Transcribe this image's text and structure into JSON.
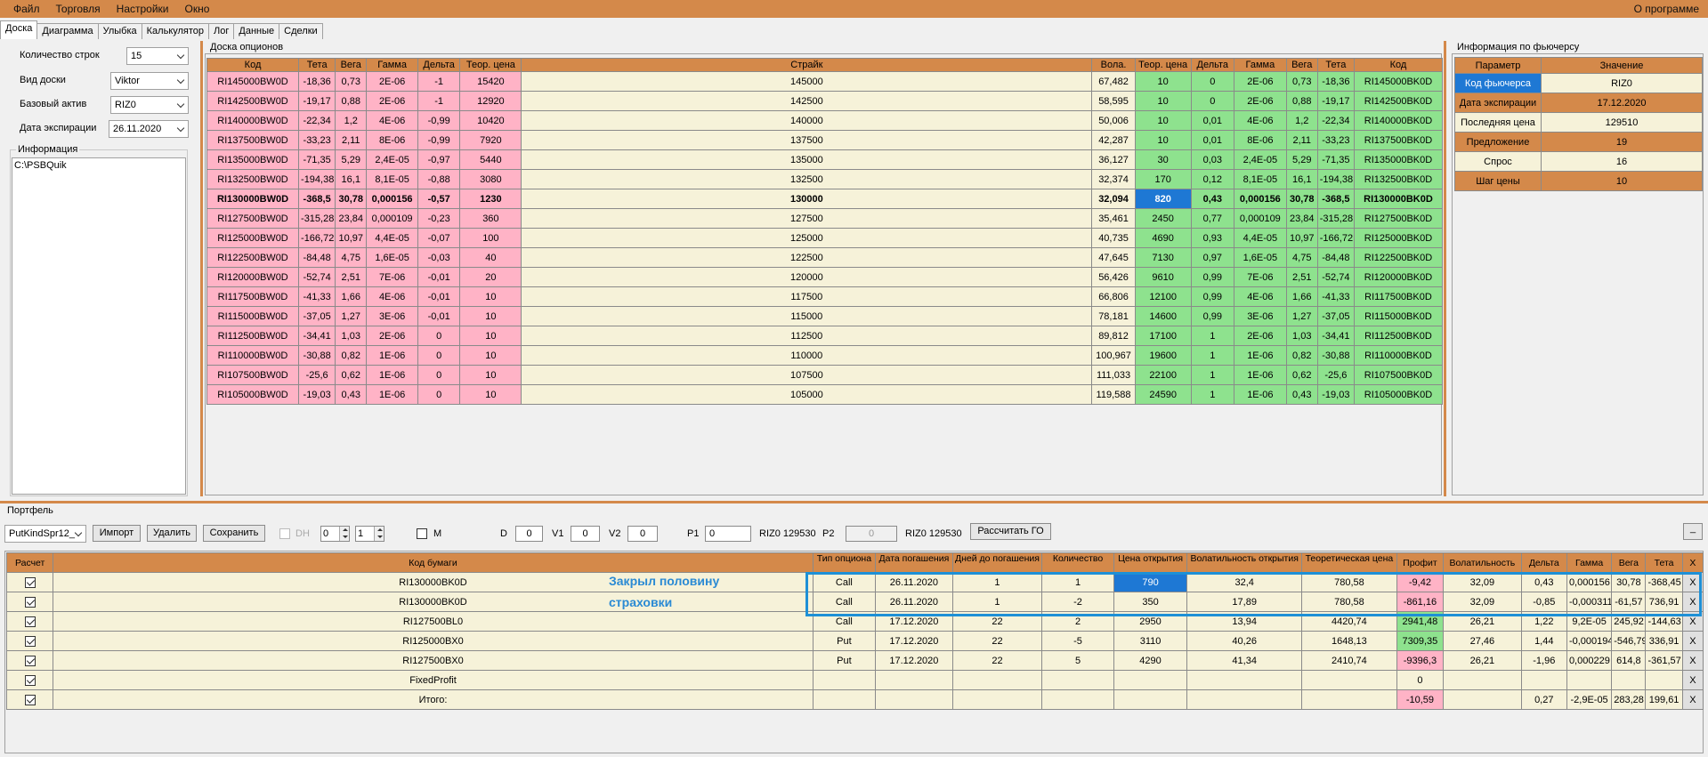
{
  "menu": [
    "Файл",
    "Торговля",
    "Настройки",
    "Окно"
  ],
  "menu_right": "О программе",
  "tabs": [
    "Доска",
    "Диаграмма",
    "Улыбка",
    "Калькулятор",
    "Лог",
    "Данные",
    "Сделки"
  ],
  "left": {
    "rows_label": "Количество строк",
    "rows_value": "15",
    "view_label": "Вид доски",
    "view_value": "Viktor",
    "asset_label": "Базовый актив",
    "asset_value": "RIZ0",
    "exp_label": "Дата экспирации",
    "exp_value": "26.11.2020",
    "info_caption": "Информация",
    "info_text": "C:\\PSBQuik"
  },
  "board": {
    "caption": "Доска опционов",
    "headers": [
      "Код",
      "Тета",
      "Вега",
      "Гамма",
      "Дельта",
      "Теор. цена",
      "Страйк",
      "Вола.",
      "Теор. цена",
      "Дельта",
      "Гамма",
      "Вега",
      "Тета",
      "Код"
    ],
    "rows": [
      [
        "RI145000BW0D",
        "-18,36",
        "0,73",
        "2E-06",
        "-1",
        "15420",
        "145000",
        "67,482",
        "10",
        "0",
        "2E-06",
        "0,73",
        "-18,36",
        "RI145000BK0D"
      ],
      [
        "RI142500BW0D",
        "-19,17",
        "0,88",
        "2E-06",
        "-1",
        "12920",
        "142500",
        "58,595",
        "10",
        "0",
        "2E-06",
        "0,88",
        "-19,17",
        "RI142500BK0D"
      ],
      [
        "RI140000BW0D",
        "-22,34",
        "1,2",
        "4E-06",
        "-0,99",
        "10420",
        "140000",
        "50,006",
        "10",
        "0,01",
        "4E-06",
        "1,2",
        "-22,34",
        "RI140000BK0D"
      ],
      [
        "RI137500BW0D",
        "-33,23",
        "2,11",
        "8E-06",
        "-0,99",
        "7920",
        "137500",
        "42,287",
        "10",
        "0,01",
        "8E-06",
        "2,11",
        "-33,23",
        "RI137500BK0D"
      ],
      [
        "RI135000BW0D",
        "-71,35",
        "5,29",
        "2,4E-05",
        "-0,97",
        "5440",
        "135000",
        "36,127",
        "30",
        "0,03",
        "2,4E-05",
        "5,29",
        "-71,35",
        "RI135000BK0D"
      ],
      [
        "RI132500BW0D",
        "-194,38",
        "16,1",
        "8,1E-05",
        "-0,88",
        "3080",
        "132500",
        "32,374",
        "170",
        "0,12",
        "8,1E-05",
        "16,1",
        "-194,38",
        "RI132500BK0D"
      ],
      [
        "RI130000BW0D",
        "-368,5",
        "30,78",
        "0,000156",
        "-0,57",
        "1230",
        "130000",
        "32,094",
        "820",
        "0,43",
        "0,000156",
        "30,78",
        "-368,5",
        "RI130000BK0D"
      ],
      [
        "RI127500BW0D",
        "-315,28",
        "23,84",
        "0,000109",
        "-0,23",
        "360",
        "127500",
        "35,461",
        "2450",
        "0,77",
        "0,000109",
        "23,84",
        "-315,28",
        "RI127500BK0D"
      ],
      [
        "RI125000BW0D",
        "-166,72",
        "10,97",
        "4,4E-05",
        "-0,07",
        "100",
        "125000",
        "40,735",
        "4690",
        "0,93",
        "4,4E-05",
        "10,97",
        "-166,72",
        "RI125000BK0D"
      ],
      [
        "RI122500BW0D",
        "-84,48",
        "4,75",
        "1,6E-05",
        "-0,03",
        "40",
        "122500",
        "47,645",
        "7130",
        "0,97",
        "1,6E-05",
        "4,75",
        "-84,48",
        "RI122500BK0D"
      ],
      [
        "RI120000BW0D",
        "-52,74",
        "2,51",
        "7E-06",
        "-0,01",
        "20",
        "120000",
        "56,426",
        "9610",
        "0,99",
        "7E-06",
        "2,51",
        "-52,74",
        "RI120000BK0D"
      ],
      [
        "RI117500BW0D",
        "-41,33",
        "1,66",
        "4E-06",
        "-0,01",
        "10",
        "117500",
        "66,806",
        "12100",
        "0,99",
        "4E-06",
        "1,66",
        "-41,33",
        "RI117500BK0D"
      ],
      [
        "RI115000BW0D",
        "-37,05",
        "1,27",
        "3E-06",
        "-0,01",
        "10",
        "115000",
        "78,181",
        "14600",
        "0,99",
        "3E-06",
        "1,27",
        "-37,05",
        "RI115000BK0D"
      ],
      [
        "RI112500BW0D",
        "-34,41",
        "1,03",
        "2E-06",
        "0",
        "10",
        "112500",
        "89,812",
        "17100",
        "1",
        "2E-06",
        "1,03",
        "-34,41",
        "RI112500BK0D"
      ],
      [
        "RI110000BW0D",
        "-30,88",
        "0,82",
        "1E-06",
        "0",
        "10",
        "110000",
        "100,967",
        "19600",
        "1",
        "1E-06",
        "0,82",
        "-30,88",
        "RI110000BK0D"
      ],
      [
        "RI107500BW0D",
        "-25,6",
        "0,62",
        "1E-06",
        "0",
        "10",
        "107500",
        "111,033",
        "22100",
        "1",
        "1E-06",
        "0,62",
        "-25,6",
        "RI107500BK0D"
      ],
      [
        "RI105000BW0D",
        "-19,03",
        "0,43",
        "1E-06",
        "0",
        "10",
        "105000",
        "119,588",
        "24590",
        "1",
        "1E-06",
        "0,43",
        "-19,03",
        "RI105000BK0D"
      ]
    ]
  },
  "futures": {
    "caption": "Информация по фьючерсу",
    "headers": [
      "Параметр",
      "Значение"
    ],
    "rows": [
      [
        "Код фьючерса",
        "RIZ0"
      ],
      [
        "Дата экспирации",
        "17.12.2020"
      ],
      [
        "Последняя цена",
        "129510"
      ],
      [
        "Предложение",
        "19"
      ],
      [
        "Спрос",
        "16"
      ],
      [
        "Шаг цены",
        "10"
      ]
    ]
  },
  "portfolio": {
    "caption": "Портфель",
    "select_value": "PutKindSpr12_",
    "import_label": "Импорт",
    "delete_label": "Удалить",
    "save_label": "Сохранить",
    "dh_label": "DH",
    "spin1": "0",
    "spin2": "1",
    "m_label": "M",
    "d_label": "D",
    "d_value": "0",
    "v1_label": "V1",
    "v1_value": "0",
    "v2_label": "V2",
    "v2_value": "0",
    "p1_label": "P1",
    "p1_value": "0",
    "riz_1": "RIZ0 129530",
    "p2_label": "P2",
    "p2_value": "0",
    "riz_2": "RIZ0 129530",
    "calc_label": "Рассчитать ГО",
    "min_label": "_",
    "headers": [
      "Расчет",
      "Код бумаги",
      "Тип опциона",
      "Дата погашения",
      "Дней до погашения",
      "Количество",
      "Цена открытия",
      "Волатильность открытия",
      "Теоретическая цена",
      "Профит",
      "Волатильность",
      "Дельта",
      "Гамма",
      "Вега",
      "Тета",
      "X"
    ],
    "rows": [
      [
        "RI130000BK0D",
        "Call",
        "26.11.2020",
        "1",
        "1",
        "790",
        "32,4",
        "780,58",
        "-9,42",
        "32,09",
        "0,43",
        "0,000156",
        "30,78",
        "-368,45",
        "X"
      ],
      [
        "RI130000BK0D",
        "Call",
        "26.11.2020",
        "1",
        "-2",
        "350",
        "17,89",
        "780,58",
        "-861,16",
        "32,09",
        "-0,85",
        "-0,000311",
        "-61,57",
        "736,91",
        "X"
      ],
      [
        "RI127500BL0",
        "Call",
        "17.12.2020",
        "22",
        "2",
        "2950",
        "13,94",
        "4420,74",
        "2941,48",
        "26,21",
        "1,22",
        "9,2E-05",
        "245,92",
        "-144,63",
        "X"
      ],
      [
        "RI125000BX0",
        "Put",
        "17.12.2020",
        "22",
        "-5",
        "3110",
        "40,26",
        "1648,13",
        "7309,35",
        "27,46",
        "1,44",
        "-0,000194",
        "-546,79",
        "336,91",
        "X"
      ],
      [
        "RI127500BX0",
        "Put",
        "17.12.2020",
        "22",
        "5",
        "4290",
        "41,34",
        "2410,74",
        "-9396,3",
        "26,21",
        "-1,96",
        "0,000229",
        "614,8",
        "-361,57",
        "X"
      ],
      [
        "FixedProfit",
        "",
        "",
        "",
        "",
        "",
        "",
        "",
        "0",
        "",
        "",
        "",
        "",
        "",
        "X"
      ],
      [
        "Итого:",
        "",
        "",
        "",
        "",
        "",
        "",
        "",
        "-10,59",
        "",
        "0,27",
        "-2,9E-05",
        "283,28",
        "199,61",
        "X"
      ]
    ]
  },
  "annotation": {
    "line1": "Закрыл половину",
    "line2": "страховки"
  },
  "colors": {
    "accent": "#d4894a",
    "pink": "#ffb3c6",
    "green": "#8ee28e",
    "select": "#1e78d4",
    "highlight": "#1e90d6"
  }
}
